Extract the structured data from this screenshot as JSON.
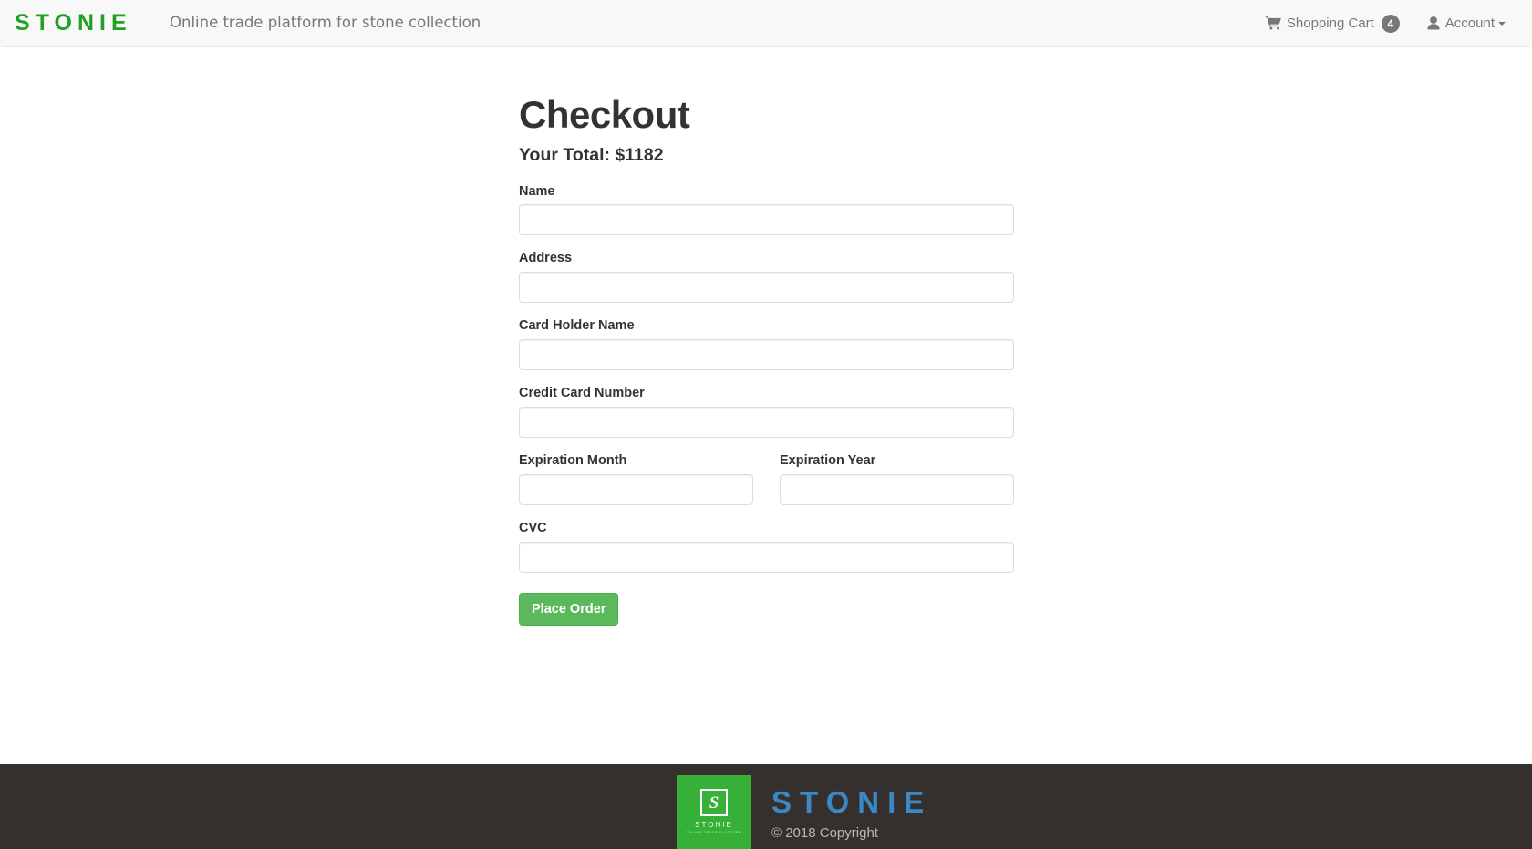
{
  "header": {
    "brand": "STONIE",
    "tagline": "Online trade platform for stone collection",
    "nav": {
      "cart_label": "Shopping Cart",
      "cart_count": "4",
      "cart_icon": "shopping-cart-icon",
      "account_label": "Account",
      "account_icon": "user-icon",
      "caret_icon": "caret-down-icon"
    }
  },
  "main": {
    "title": "Checkout",
    "total": "Your Total: $1182",
    "fields": [
      {
        "label": "Name",
        "value": "",
        "placeholder": ""
      },
      {
        "label": "Address",
        "value": "",
        "placeholder": ""
      },
      {
        "label": "Card Holder Name",
        "value": "",
        "placeholder": ""
      },
      {
        "label": "Credit Card Number",
        "value": "",
        "placeholder": ""
      },
      {
        "label": "Expiration Month",
        "value": "",
        "placeholder": ""
      },
      {
        "label": "Expiration Year",
        "value": "",
        "placeholder": ""
      },
      {
        "label": "CVC",
        "value": "",
        "placeholder": ""
      }
    ],
    "submit_label": "Place Order"
  },
  "footer": {
    "logo_mark": "S",
    "logo_tile_name": "STONIE",
    "logo_tile_tagline": "ONLINE TRADE PLATFORM",
    "brand": "STONIE",
    "copyright": "© 2018 Copyright"
  },
  "colors": {
    "brand_green": "#21a121",
    "button_green": "#5cb85c",
    "logo_tile_green": "#36b036",
    "footer_blue": "#3a88c4",
    "footer_bg": "#35302e",
    "navbar_bg": "#f8f8f8",
    "muted_text": "#777777",
    "body_text": "#333333"
  }
}
